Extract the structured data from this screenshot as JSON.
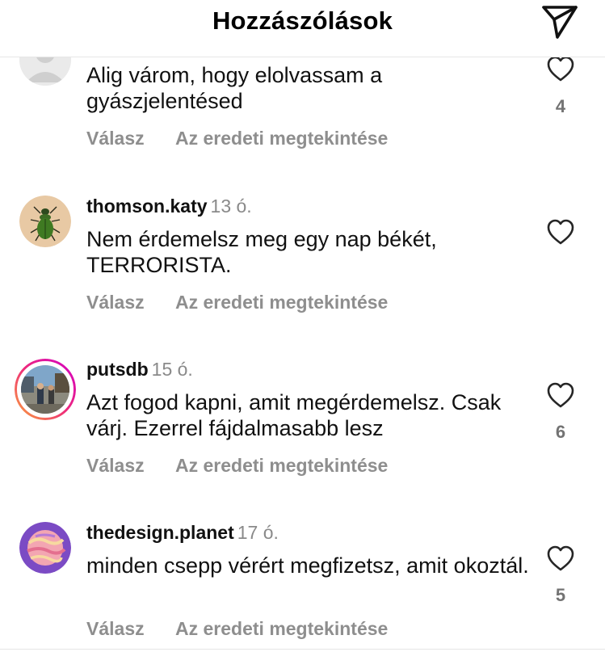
{
  "header": {
    "title": "Hozzászólások",
    "share_icon": "paper-plane-icon"
  },
  "comments": [
    {
      "username": "",
      "time": "",
      "text": "Alig várom, hogy elolvassam a gyászjelentésed",
      "reply_label": "Válasz",
      "view_original_label": "Az eredeti megtekintése",
      "likes": "4",
      "avatar_icon": "default-avatar-icon"
    },
    {
      "username": "thomson.katy",
      "time": "13 ó.",
      "text": "Nem érdemelsz meg egy nap békét, TERRORISTA.",
      "reply_label": "Válasz",
      "view_original_label": "Az eredeti megtekintése",
      "likes": "",
      "avatar_icon": "beetle-avatar-icon"
    },
    {
      "username": "putsdb",
      "time": "15 ó.",
      "text": "Azt fogod kapni, amit megérdemelsz. Csak várj. Ezerrel fájdalmasabb lesz",
      "reply_label": "Válasz",
      "view_original_label": "Az eredeti megtekintése",
      "likes": "6",
      "avatar_icon": "story-ring-avatar-icon"
    },
    {
      "username": "thedesign.planet",
      "time": "17 ó.",
      "text": "minden csepp vérért megfizetsz, amit okoztál.",
      "reply_label": "Válasz",
      "view_original_label": "Az eredeti megtekintése",
      "likes": "5",
      "avatar_icon": "planet-avatar-icon"
    }
  ],
  "colors": {
    "secondary_text": "#8e8e8e",
    "story_ring_start": "#f9a23c",
    "story_ring_end": "#d300c5",
    "planet_purple": "#7b4bc4"
  }
}
